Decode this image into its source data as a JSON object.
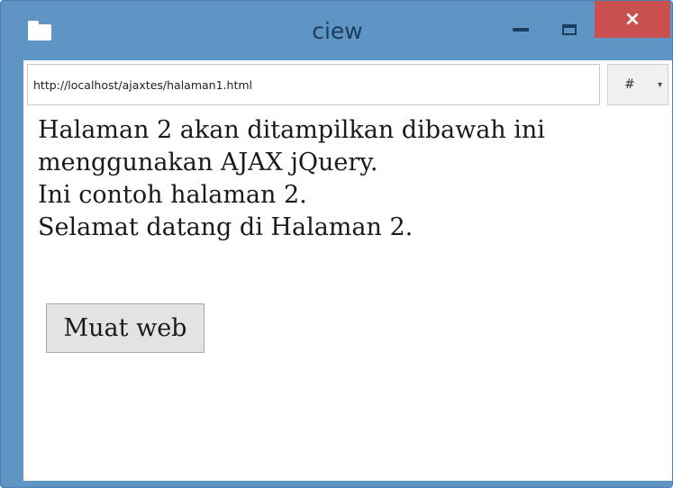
{
  "window": {
    "title": "ciew",
    "close_symbol": "×",
    "icons": [
      "app-window-icon",
      "minimize-icon",
      "maximize-icon",
      "close-icon"
    ],
    "colors": {
      "frame": "#5f95c4",
      "close": "#c9504f"
    }
  },
  "addressbar": {
    "url": "http://localhost/ajaxtes/halaman1.html",
    "anchor_value": "#",
    "anchor_icon": "chevron-down-icon"
  },
  "page": {
    "lines": [
      "Halaman 2 akan ditampilkan dibawah ini",
      "menggunakan AJAX jQuery.",
      "Ini contoh halaman 2.",
      "Selamat datang di Halaman 2."
    ],
    "button_label": "Muat web"
  }
}
